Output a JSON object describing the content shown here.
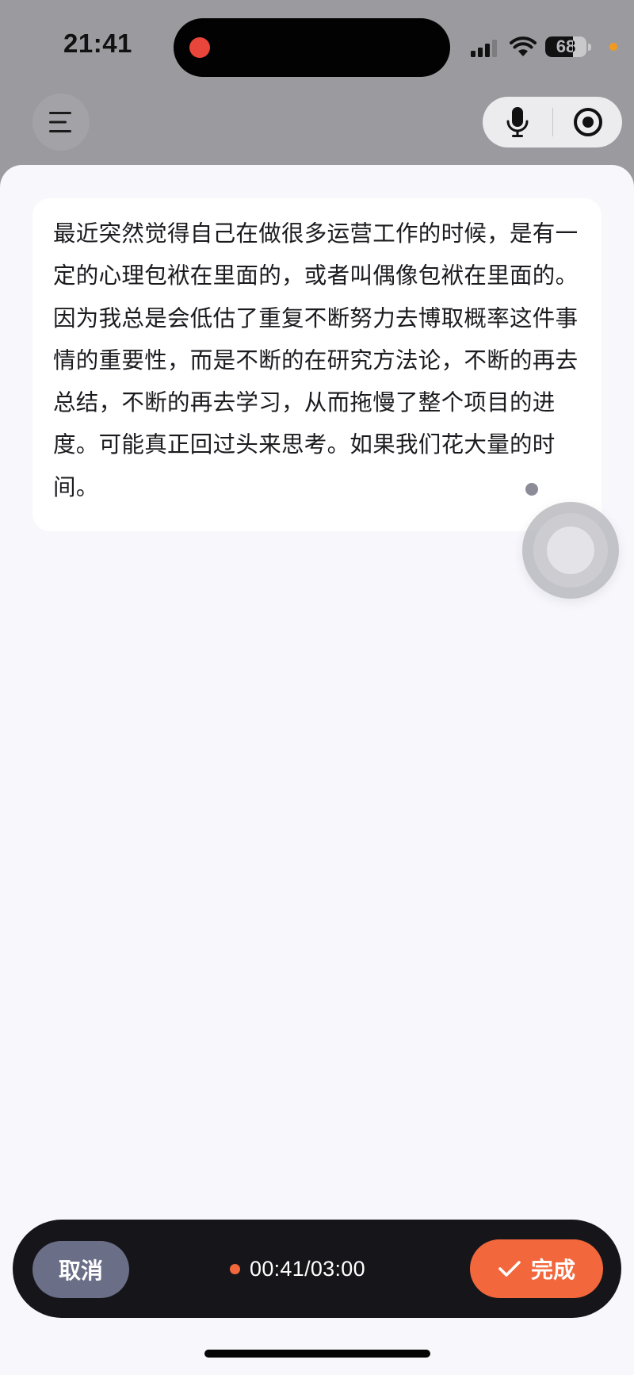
{
  "status_bar": {
    "time": "21:41",
    "battery_level": "68",
    "battery_fraction": 0.68,
    "recording_indicator_color": "#e8463b",
    "privacy_dot_color": "#f29a1e"
  },
  "toolbar": {
    "menu_icon": "menu-icon",
    "mic_icon": "microphone-icon",
    "record_icon": "record-target-icon"
  },
  "transcript": {
    "text": "最近突然觉得自己在做很多运营工作的时候，是有一定的心理包袱在里面的，或者叫偶像包袱在里面的。因为我总是会低估了重复不断努力去博取概率这件事情的重要性，而是不断的在研究方法论，不断的再去总结，不断的再去学习，从而拖慢了整个项目的进度。可能真正回过头来思考。如果我们花大量的时间。"
  },
  "controls": {
    "cancel_label": "取消",
    "timer": "00:41/03:00",
    "done_label": "完成",
    "accent_color": "#f2673b"
  }
}
